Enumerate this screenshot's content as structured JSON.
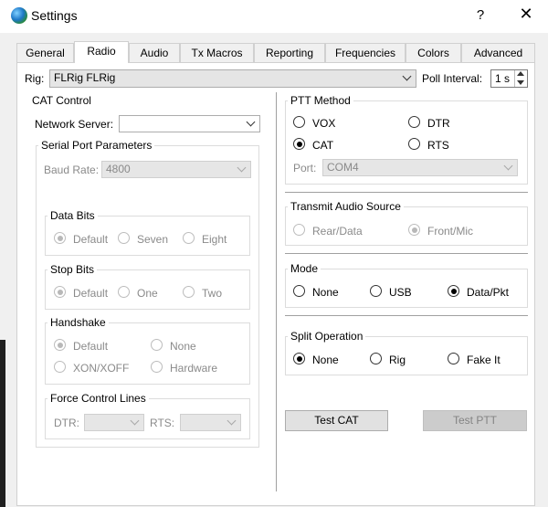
{
  "window": {
    "title": "Settings",
    "help_label": "?",
    "close_label": "✕"
  },
  "tabs": [
    "General",
    "Radio",
    "Audio",
    "Tx Macros",
    "Reporting",
    "Frequencies",
    "Colors",
    "Advanced"
  ],
  "active_tab": "Radio",
  "rig": {
    "label": "Rig:",
    "value": "FLRig FLRig",
    "poll_label": "Poll Interval:",
    "poll_value": "1 s"
  },
  "cat": {
    "title": "CAT Control",
    "network_label": "Network Server:",
    "network_value": "",
    "serial": {
      "title": "Serial Port Parameters",
      "baud_label": "Baud Rate:",
      "baud_value": "4800",
      "data_bits": {
        "title": "Data Bits",
        "options": [
          "Default",
          "Seven",
          "Eight"
        ],
        "selected": "Default"
      },
      "stop_bits": {
        "title": "Stop Bits",
        "options": [
          "Default",
          "One",
          "Two"
        ],
        "selected": "Default"
      },
      "handshake": {
        "title": "Handshake",
        "options": [
          "Default",
          "None",
          "XON/XOFF",
          "Hardware"
        ],
        "selected": "Default"
      },
      "force": {
        "title": "Force Control Lines",
        "dtr_label": "DTR:",
        "rts_label": "RTS:",
        "dtr_value": "",
        "rts_value": ""
      }
    }
  },
  "ptt": {
    "title": "PTT Method",
    "options": [
      "VOX",
      "DTR",
      "CAT",
      "RTS"
    ],
    "selected": "CAT",
    "port_label": "Port:",
    "port_value": "COM4"
  },
  "tx_audio": {
    "title": "Transmit Audio Source",
    "options": [
      "Rear/Data",
      "Front/Mic"
    ],
    "selected": "Front/Mic"
  },
  "mode": {
    "title": "Mode",
    "options": [
      "None",
      "USB",
      "Data/Pkt"
    ],
    "selected": "Data/Pkt"
  },
  "split": {
    "title": "Split Operation",
    "options": [
      "None",
      "Rig",
      "Fake It"
    ],
    "selected": "None"
  },
  "buttons": {
    "test_cat": "Test CAT",
    "test_ptt": "Test PTT"
  }
}
